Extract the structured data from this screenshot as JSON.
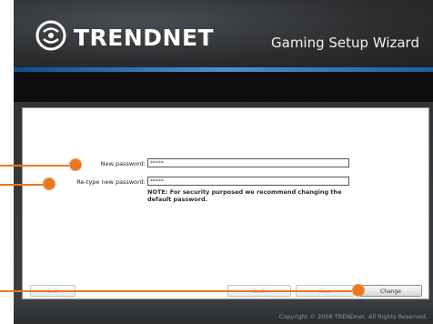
{
  "header": {
    "brand": "TRENDNET",
    "wizard_title": "Gaming Setup Wizard"
  },
  "form": {
    "new_password_label": "New password:",
    "new_password_value": "*****",
    "retype_password_label": "Re-type new password:",
    "retype_password_value": "*****",
    "note": "NOTE: For security purposed we recommend changing the default password."
  },
  "buttons": {
    "exit": "Exit",
    "back": "Back",
    "skip": "Skip",
    "change": "Change"
  },
  "footer": {
    "copyright": "Copyright © 2008 TRENDnet. All Rights Reserved."
  },
  "colors": {
    "callout": "#e87722",
    "accent_stripe": "#4d8fd0",
    "header_dark": "#2a2c2e"
  },
  "icons": [
    "trendnet-logo-icon"
  ]
}
